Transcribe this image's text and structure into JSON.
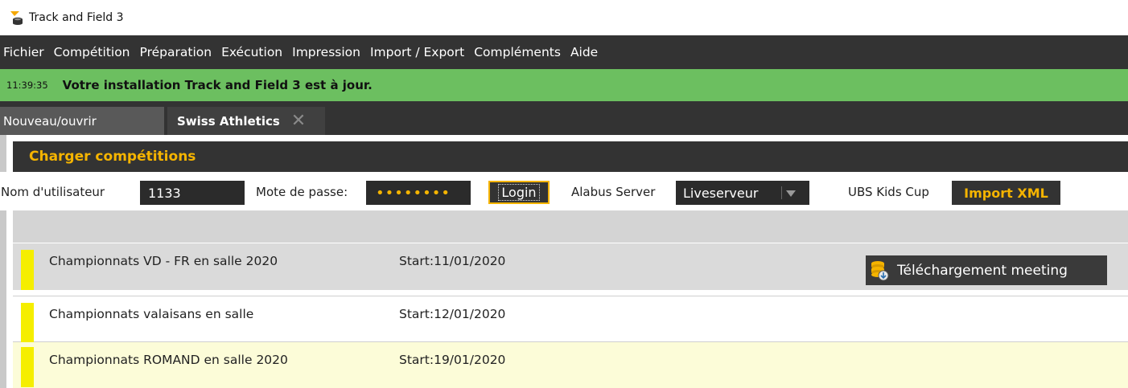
{
  "window": {
    "title": "Track and Field 3"
  },
  "menu": [
    "Fichier",
    "Compétition",
    "Préparation",
    "Exécution",
    "Impression",
    "Import / Export",
    "Compléments",
    "Aide"
  ],
  "status": {
    "time": "11:39:35",
    "message": "Votre installation Track and Field 3 est à jour.",
    "color": "#6cbf60"
  },
  "tabs": {
    "new_label": "Nouveau/ouvrir",
    "active_label": "Swiss Athletics",
    "close_glyph": "✕"
  },
  "panel": {
    "title": "Charger compétitions",
    "accent": "#f5b400"
  },
  "login": {
    "username_label": "Nom d'utilisateur",
    "username_value": "1133",
    "password_label": "Mote de passe:",
    "password_value": "••••••••",
    "login_button": "Login",
    "server_label": "Alabus Server",
    "server_value": "Liveserveur",
    "kids_label": "UBS Kids Cup",
    "import_button": "Import XML"
  },
  "competitions": [
    {
      "name": "Championnats VD - FR en salle 2020",
      "start": "Start:11/01/2020"
    },
    {
      "name": "Championnats valaisans en salle",
      "start": "Start:12/01/2020"
    },
    {
      "name": "Championnats ROMAND en salle 2020",
      "start": "Start:19/01/2020"
    }
  ],
  "download_button": "Téléchargement meeting",
  "icons": {
    "app": "track-field-app-icon",
    "download": "database-download-icon",
    "chevron": "chevron-down-icon",
    "close": "close-icon"
  }
}
